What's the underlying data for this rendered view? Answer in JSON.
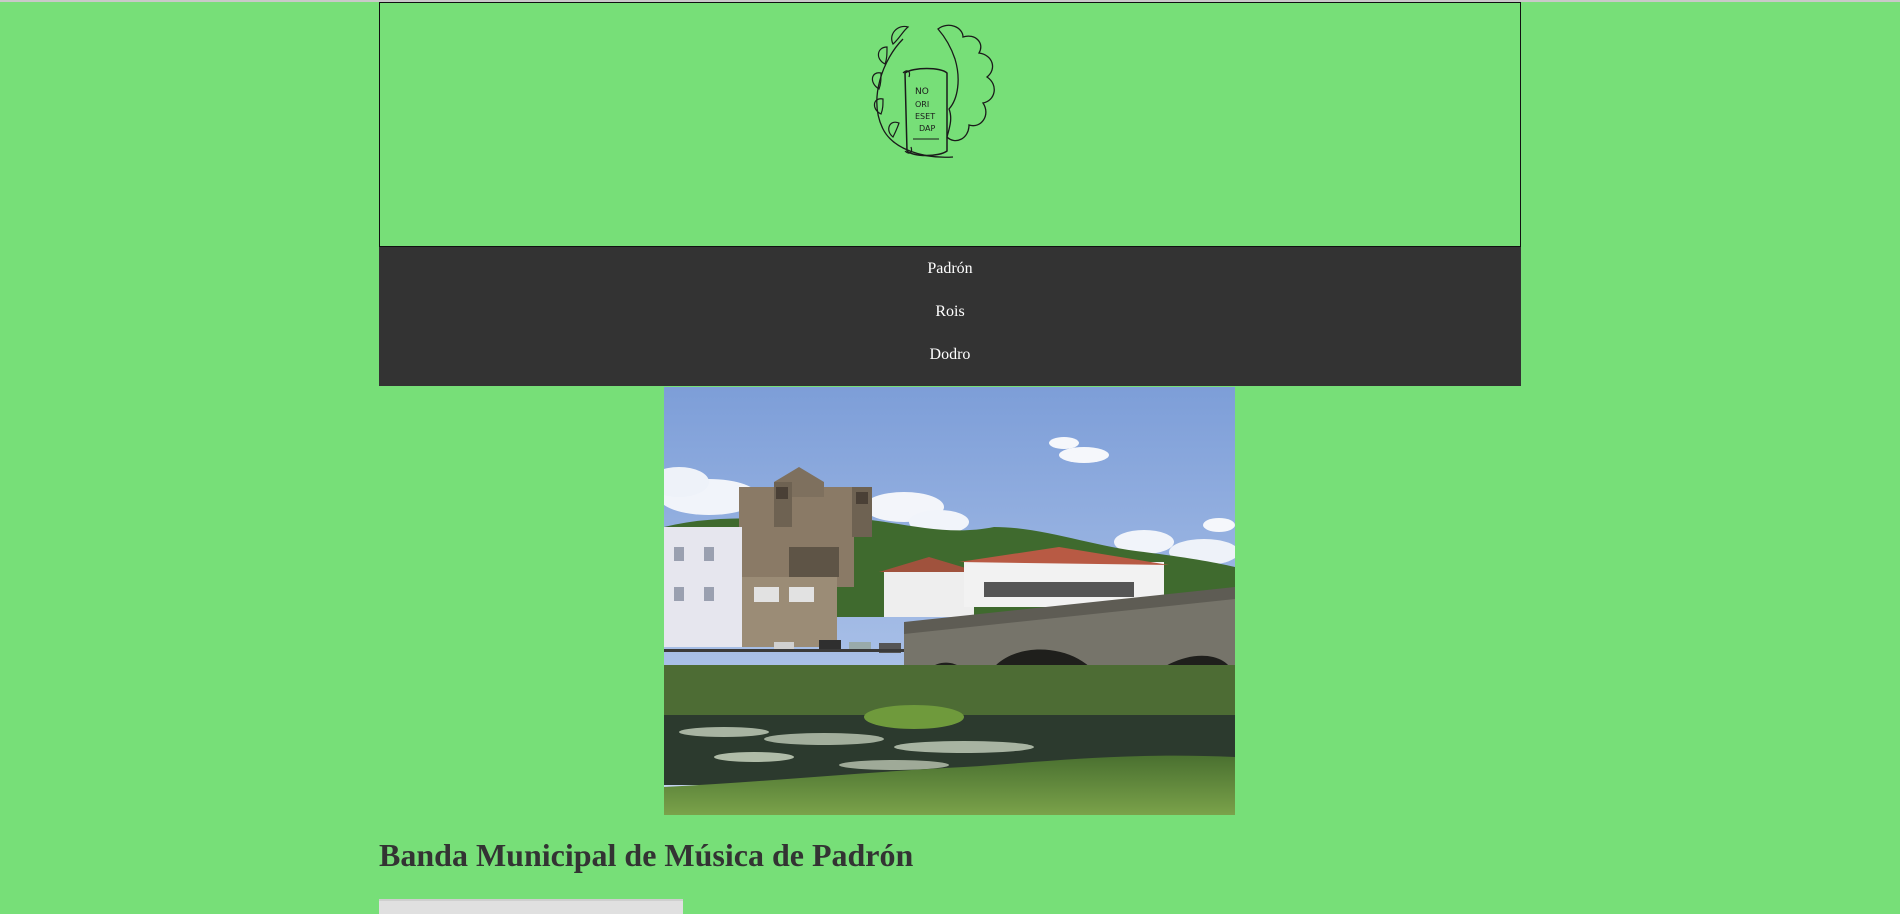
{
  "header": {
    "logo_icon": "orchestra-scroll-logo",
    "logo_text": "NO ORI ESET DAP"
  },
  "nav": {
    "items": [
      {
        "label": "Padrón"
      },
      {
        "label": "Rois"
      },
      {
        "label": "Dodro"
      }
    ]
  },
  "main": {
    "photo_icon": "padron-bridge-church-photo",
    "heading": "Banda Municipal de Música de Padrón"
  },
  "colors": {
    "background": "#77df78",
    "nav_bg": "#333333",
    "nav_text": "#ffffff",
    "heading": "#333333"
  }
}
